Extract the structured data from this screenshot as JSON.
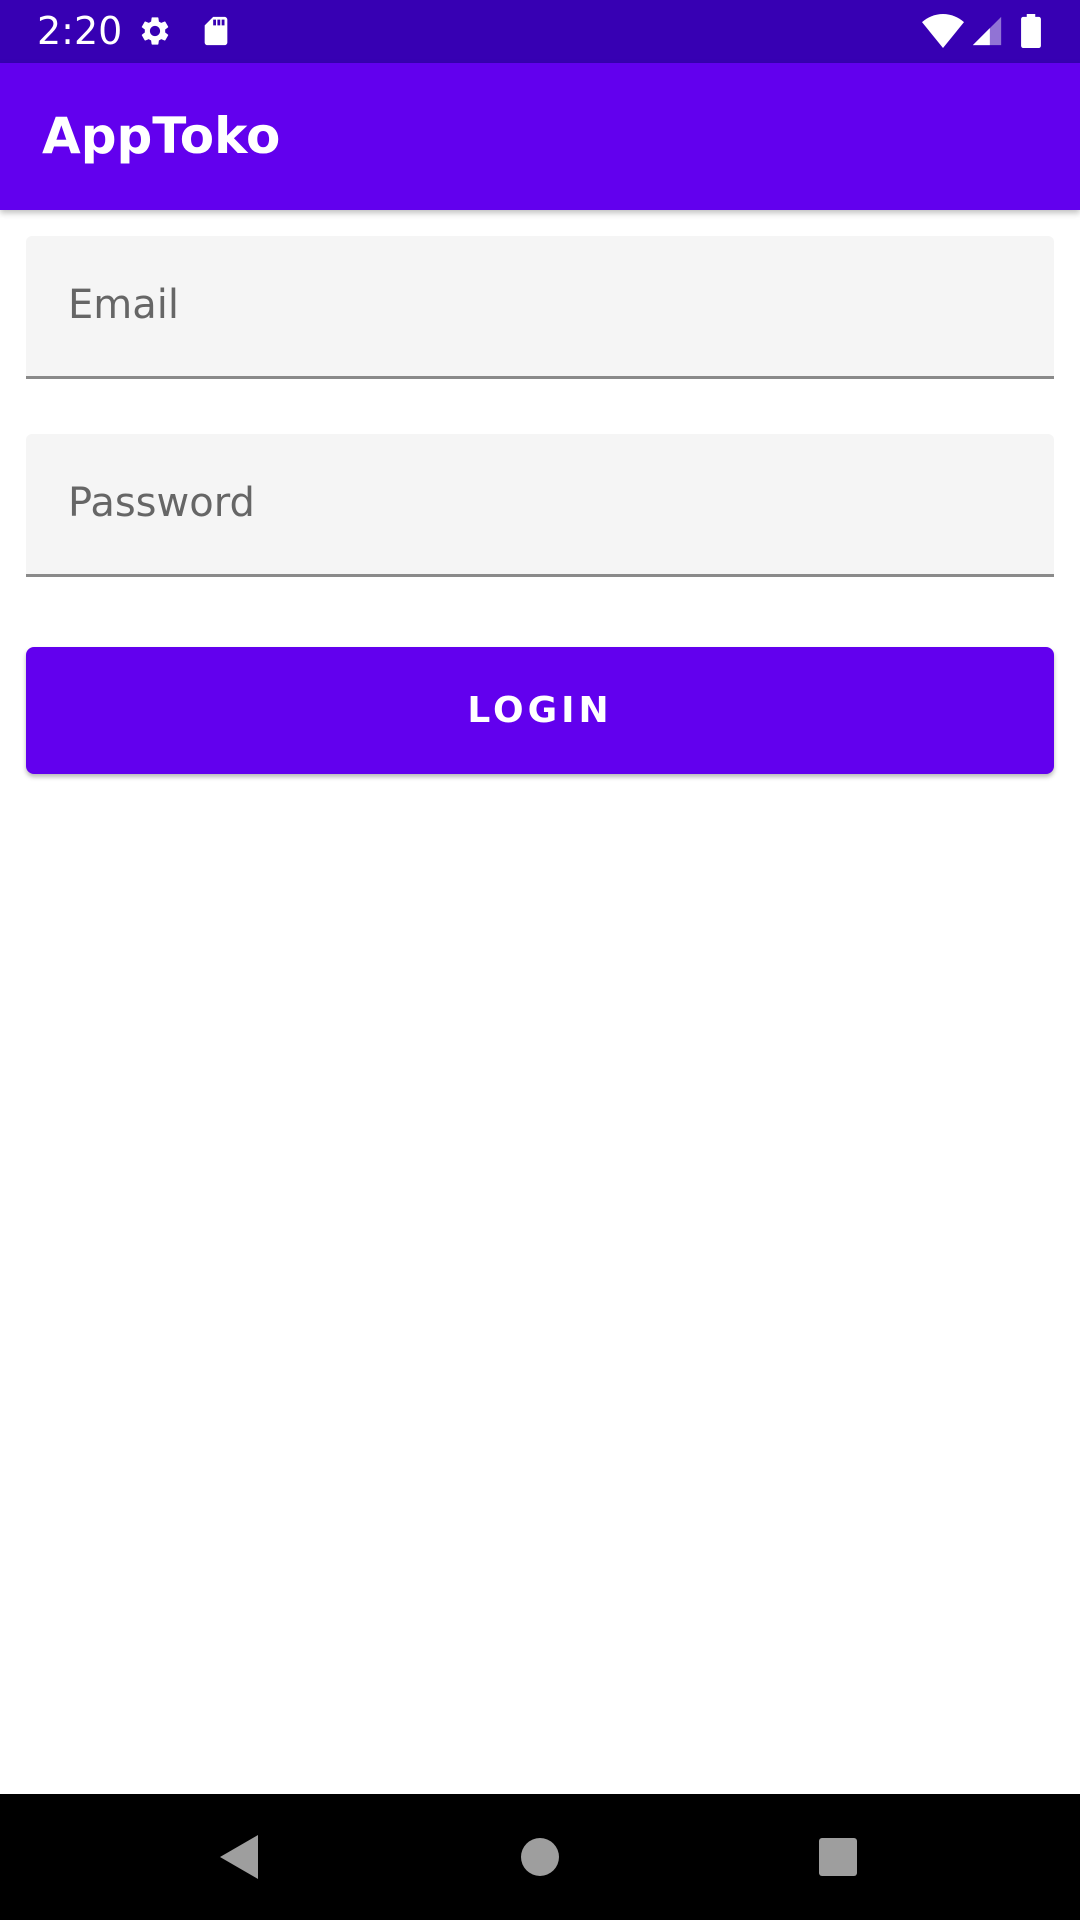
{
  "status_bar": {
    "time": "2:20",
    "icons": [
      "gear-icon",
      "sd-card-icon",
      "wifi-icon",
      "cell-signal-icon",
      "battery-icon"
    ],
    "background_color": "#3700b3"
  },
  "app_bar": {
    "title": "AppToko",
    "background_color": "#6200ee"
  },
  "form": {
    "email_placeholder": "Email",
    "email_value": "",
    "password_placeholder": "Password",
    "password_value": "",
    "login_label": "LOGIN"
  },
  "nav_bar": {
    "icons": [
      "back-icon",
      "home-icon",
      "recents-icon"
    ]
  }
}
